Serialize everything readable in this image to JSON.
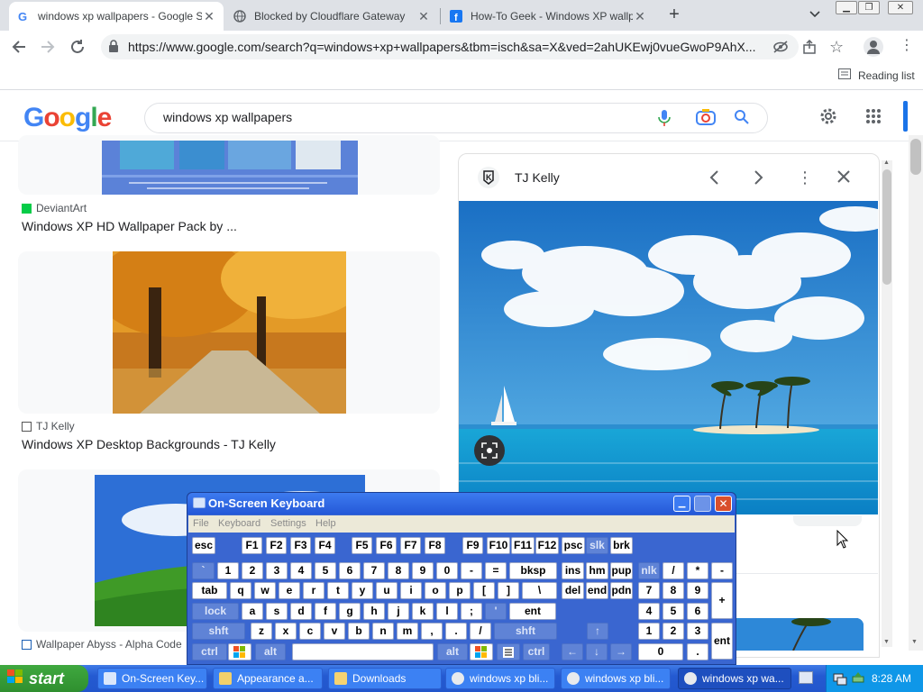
{
  "browser": {
    "tabs": [
      {
        "title": "windows xp wallpapers - Google Se",
        "active": true
      },
      {
        "title": "Blocked by Cloudflare Gateway",
        "active": false
      },
      {
        "title": "How-To Geek - Windows XP wallpa",
        "active": false
      }
    ],
    "url": "https://www.google.com/search?q=windows+xp+wallpapers&tbm=isch&sa=X&ved=2ahUKEwj0vueGwoP9AhX...",
    "reading_list": "Reading list"
  },
  "google": {
    "logo": "Google",
    "query": "windows xp wallpapers"
  },
  "results": [
    {
      "source": "DeviantArt",
      "title": "Windows XP HD Wallpaper Pack by ..."
    },
    {
      "source": "TJ Kelly",
      "title": "Windows XP Desktop Backgrounds - TJ Kelly"
    },
    {
      "source": "Wallpaper Abyss - Alpha Code"
    }
  ],
  "preview": {
    "source": "TJ Kelly"
  },
  "osk": {
    "title": "On-Screen Keyboard",
    "menu": [
      "File",
      "Keyboard",
      "Settings",
      "Help"
    ],
    "rows": {
      "r1": [
        "esc",
        "F1",
        "F2",
        "F3",
        "F4",
        "F5",
        "F6",
        "F7",
        "F8",
        "F9",
        "F10",
        "F11",
        "F12",
        "psc",
        "slk",
        "brk"
      ],
      "r2": [
        "`",
        "1",
        "2",
        "3",
        "4",
        "5",
        "6",
        "7",
        "8",
        "9",
        "0",
        "-",
        "=",
        "bksp",
        "ins",
        "hm",
        "pup",
        "nlk",
        "/",
        "*",
        "-"
      ],
      "r3": [
        "tab",
        "q",
        "w",
        "e",
        "r",
        "t",
        "y",
        "u",
        "i",
        "o",
        "p",
        "[",
        "]",
        "\\",
        "del",
        "end",
        "pdn",
        "7",
        "8",
        "9",
        "+"
      ],
      "r4": [
        "lock",
        "a",
        "s",
        "d",
        "f",
        "g",
        "h",
        "j",
        "k",
        "l",
        ";",
        "'",
        "ent",
        "4",
        "5",
        "6"
      ],
      "r5": [
        "shft",
        "z",
        "x",
        "c",
        "v",
        "b",
        "n",
        "m",
        ",",
        ".",
        "/",
        "shft",
        "↑",
        "1",
        "2",
        "3",
        "ent"
      ],
      "r6": [
        "ctrl",
        "alt",
        "alt",
        "ctrl",
        "←",
        "↓",
        "→",
        "0",
        "."
      ]
    }
  },
  "taskbar": {
    "start": "start",
    "items": [
      "On-Screen Key...",
      "Appearance a...",
      "Downloads",
      "windows xp bli...",
      "windows xp bli...",
      "windows xp wa..."
    ],
    "clock": "8:28 AM"
  }
}
